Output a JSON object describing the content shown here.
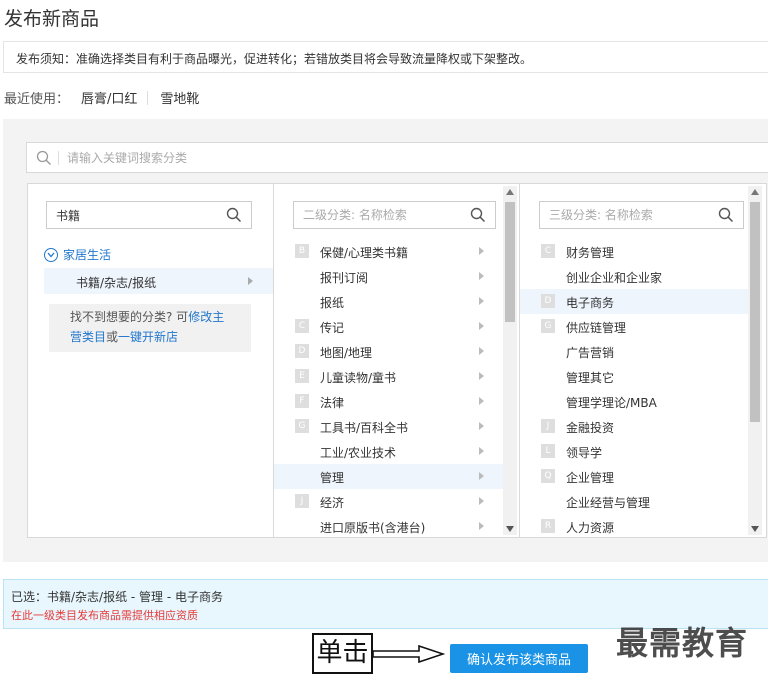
{
  "page": {
    "title": "发布新商品"
  },
  "notice": {
    "text": "发布须知：准确选择类目有利于商品曝光，促进转化；若错放类目将会导致流量降权或下架整改。"
  },
  "recent": {
    "label": "最近使用：",
    "items": [
      "唇膏/口红",
      "雪地靴"
    ]
  },
  "search": {
    "placeholder": "请输入关键词搜索分类"
  },
  "level1": {
    "search_value": "书籍",
    "parent": "家居生活",
    "child": "书籍/杂志/报纸",
    "not_found_prefix": "找不到想要的分类? 可",
    "not_found_link1": "修改主",
    "not_found_link2": "营类目",
    "not_found_mid": "或",
    "not_found_link3": "一键开新店"
  },
  "level2": {
    "placeholder": "二级分类: 名称检索",
    "items": [
      {
        "letter": "B",
        "label": "保健/心理类书籍"
      },
      {
        "letter": "",
        "label": "报刊订阅"
      },
      {
        "letter": "",
        "label": "报纸"
      },
      {
        "letter": "C",
        "label": "传记"
      },
      {
        "letter": "D",
        "label": "地图/地理"
      },
      {
        "letter": "E",
        "label": "儿童读物/童书"
      },
      {
        "letter": "F",
        "label": "法律"
      },
      {
        "letter": "G",
        "label": "工具书/百科全书"
      },
      {
        "letter": "",
        "label": "工业/农业技术"
      },
      {
        "letter": "",
        "label": "管理",
        "selected": true
      },
      {
        "letter": "J",
        "label": "经济"
      },
      {
        "letter": "",
        "label": "进口原版书(含港台)"
      }
    ]
  },
  "level3": {
    "placeholder": "三级分类: 名称检索",
    "items": [
      {
        "letter": "C",
        "label": "财务管理"
      },
      {
        "letter": "",
        "label": "创业企业和企业家"
      },
      {
        "letter": "D",
        "label": "电子商务",
        "selected": true
      },
      {
        "letter": "G",
        "label": "供应链管理"
      },
      {
        "letter": "",
        "label": "广告营销"
      },
      {
        "letter": "",
        "label": "管理其它"
      },
      {
        "letter": "",
        "label": "管理学理论/MBA"
      },
      {
        "letter": "J",
        "label": "金融投资"
      },
      {
        "letter": "L",
        "label": "领导学"
      },
      {
        "letter": "Q",
        "label": "企业管理"
      },
      {
        "letter": "",
        "label": "企业经营与管理"
      },
      {
        "letter": "R",
        "label": "人力资源"
      }
    ]
  },
  "selected": {
    "path": "已选：书籍/杂志/报纸 - 管理 - 电子商务",
    "warning": "在此一级类目发布商品需提供相应资质"
  },
  "annotation": {
    "label": "单击"
  },
  "confirm": {
    "label": "确认发布该类商品"
  },
  "watermark": {
    "text": "最需教育"
  },
  "colors": {
    "accent": "#1a93e6",
    "link": "#2277cc",
    "warning": "#e63a3a",
    "selected_row": "#eef5fd"
  }
}
